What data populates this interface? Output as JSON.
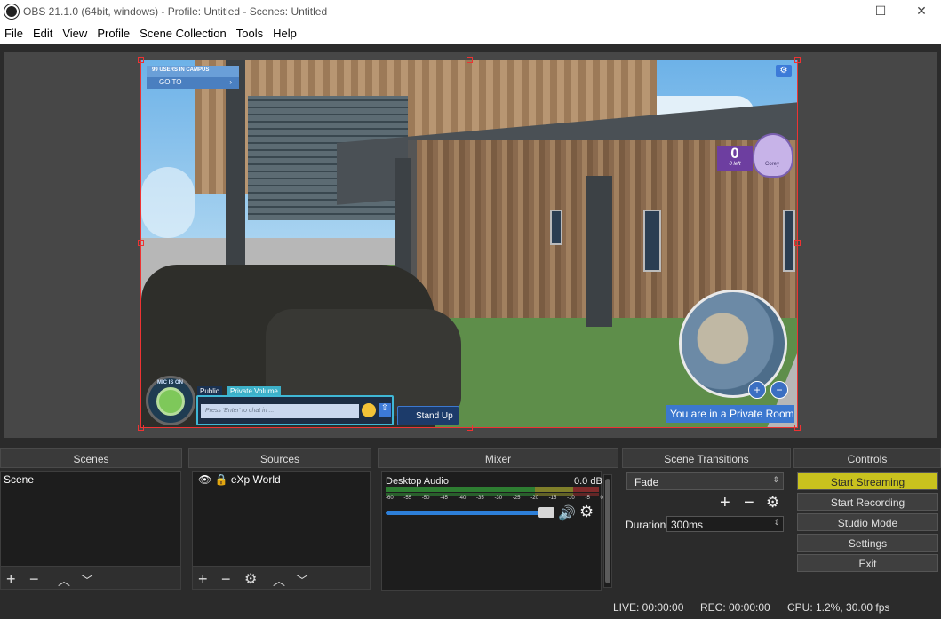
{
  "window": {
    "title": "OBS 21.1.0 (64bit, windows) - Profile: Untitled - Scenes: Untitled",
    "minimize": "—",
    "maximize": "☐",
    "close": "✕"
  },
  "menu": [
    "File",
    "Edit",
    "View",
    "Profile",
    "Scene Collection",
    "Tools",
    "Help"
  ],
  "preview": {
    "users_in_campus": "99 USERS IN CAMPUS",
    "goto": "GO TO",
    "goto_arrow": "›",
    "score": "0",
    "score_left": "0 left",
    "owl_label": "Corey",
    "private_room": "You are in a Private Room",
    "public_tag": "Public",
    "private_volume_tag": "Private Volume",
    "chat_placeholder": "Press 'Enter' to chat in ...",
    "stand_up": "Stand Up",
    "mic_label": "MIC IS ON"
  },
  "docks": {
    "scenes": {
      "title": "Scenes",
      "items": [
        "Scene"
      ]
    },
    "sources": {
      "title": "Sources",
      "items": [
        "eXp World"
      ]
    },
    "mixer": {
      "title": "Mixer",
      "channel": "Desktop Audio",
      "level": "0.0 dB",
      "ticks": [
        "-60",
        "-55",
        "-50",
        "-45",
        "-40",
        "-35",
        "-30",
        "-25",
        "-20",
        "-15",
        "-10",
        "-5",
        "0"
      ],
      "volume_fraction": 0.95
    },
    "transitions": {
      "title": "Scene Transitions",
      "selected": "Fade",
      "duration_label": "Duration",
      "duration_value": "300ms"
    },
    "controls": {
      "title": "Controls",
      "buttons": [
        "Start Streaming",
        "Start Recording",
        "Studio Mode",
        "Settings",
        "Exit"
      ]
    }
  },
  "status": {
    "live": "LIVE: 00:00:00",
    "rec": "REC: 00:00:00",
    "cpu": "CPU: 1.2%, 30.00 fps"
  },
  "colors": {
    "accent_highlight": "#c9c21e",
    "selection_red": "#e33333",
    "volume_blue": "#2d7fd8"
  }
}
